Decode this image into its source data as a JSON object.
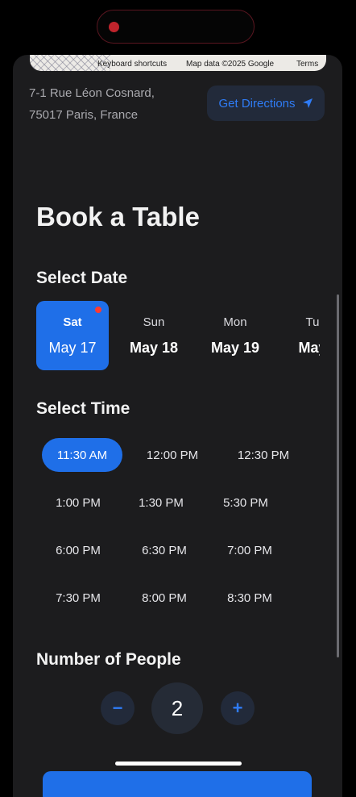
{
  "map": {
    "keyboard_shortcuts": "Keyboard shortcuts",
    "map_data": "Map data ©2025 Google",
    "terms": "Terms"
  },
  "address": {
    "line1": "7-1 Rue Léon Cosnard,",
    "line2": "75017 Paris, France"
  },
  "directions": {
    "label": "Get Directions",
    "icon": "navigation-arrow-icon"
  },
  "booking": {
    "title": "Book a Table",
    "select_date_label": "Select Date",
    "dates": [
      {
        "day": "Sat",
        "date": "May 17",
        "selected": true
      },
      {
        "day": "Sun",
        "date": "May 18",
        "selected": false
      },
      {
        "day": "Mon",
        "date": "May 19",
        "selected": false
      },
      {
        "day": "Tu",
        "date": "May",
        "selected": false
      }
    ],
    "select_time_label": "Select Time",
    "times": [
      "11:30 AM",
      "12:00 PM",
      "12:30 PM",
      "1:00 PM",
      "1:30 PM",
      "5:30 PM",
      "6:00 PM",
      "6:30 PM",
      "7:00 PM",
      "7:30 PM",
      "8:00 PM",
      "8:30 PM"
    ],
    "selected_time": "11:30 AM",
    "people_label": "Number of People",
    "people_count": "2",
    "decrement_label": "−",
    "increment_label": "+"
  },
  "colors": {
    "accent": "#1f6fe8",
    "accent_text": "#2f7cf6",
    "sheet_bg": "#1c1c1e",
    "notification_dot": "#ff3b30"
  }
}
